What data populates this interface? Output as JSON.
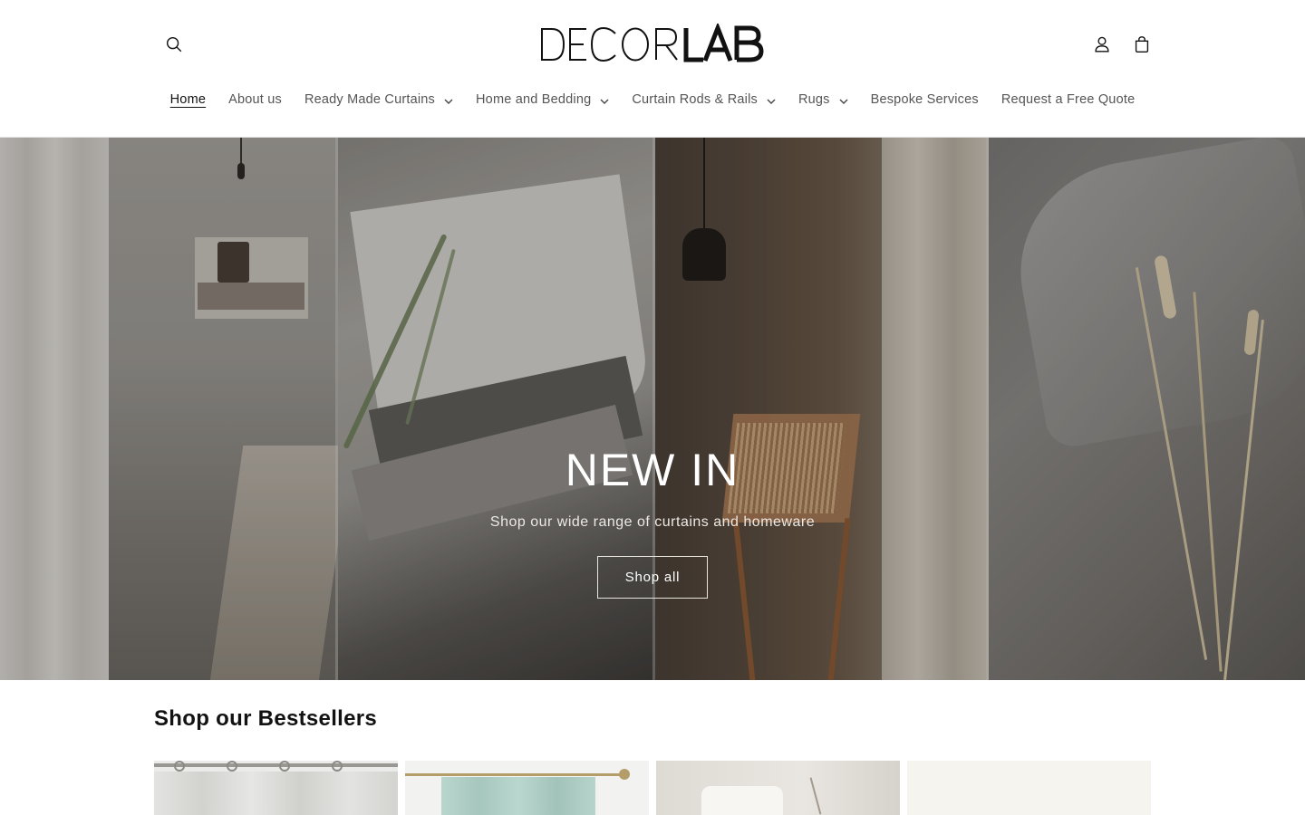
{
  "header": {
    "logo_text": "DECORLAB",
    "icons": {
      "search": "search-icon",
      "account": "account-icon",
      "cart": "cart-icon"
    }
  },
  "nav": {
    "items": [
      {
        "label": "Home",
        "active": true,
        "has_dropdown": false
      },
      {
        "label": "About us",
        "active": false,
        "has_dropdown": false
      },
      {
        "label": "Ready Made Curtains",
        "active": false,
        "has_dropdown": true
      },
      {
        "label": "Home and Bedding",
        "active": false,
        "has_dropdown": true
      },
      {
        "label": "Curtain Rods & Rails",
        "active": false,
        "has_dropdown": true
      },
      {
        "label": "Rugs",
        "active": false,
        "has_dropdown": true
      },
      {
        "label": "Bespoke Services",
        "active": false,
        "has_dropdown": false
      },
      {
        "label": "Request a Free Quote",
        "active": false,
        "has_dropdown": false
      }
    ]
  },
  "hero": {
    "title": "NEW IN",
    "subtitle": "Shop our wide range of curtains and homeware",
    "button_label": "Shop all"
  },
  "bestsellers": {
    "title": "Shop our Bestsellers",
    "product_count_visible": 4
  },
  "colors": {
    "text": "#121212",
    "nav_text": "#555555",
    "hero_overlay": "#3b3835",
    "background": "#ffffff"
  }
}
